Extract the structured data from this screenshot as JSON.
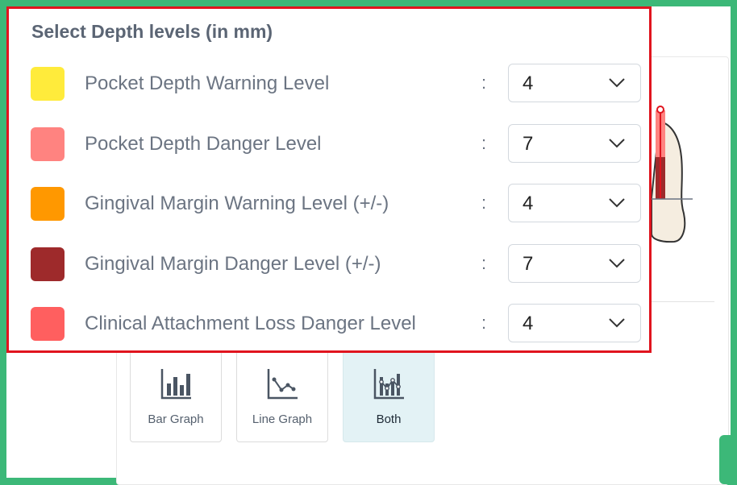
{
  "panel": {
    "title": "Select Depth levels (in mm)",
    "rows": [
      {
        "label": "Pocket Depth Warning Level",
        "color": "#ffeb3b",
        "value": "4"
      },
      {
        "label": "Pocket Depth Danger Level",
        "color": "#ff8380",
        "value": "7"
      },
      {
        "label": "Gingival Margin Warning Level (+/-)",
        "color": "#ff9800",
        "value": "4"
      },
      {
        "label": "Gingival Margin Danger Level (+/-)",
        "color": "#9e2a2b",
        "value": "7"
      },
      {
        "label": "Clinical Attachment Loss Danger Level",
        "color": "#ff5f5f",
        "value": "4"
      }
    ],
    "separator": ":"
  },
  "graph_types": {
    "buttons": [
      {
        "label": "Bar Graph",
        "icon": "bar-chart-icon"
      },
      {
        "label": "Line Graph",
        "icon": "line-chart-icon"
      },
      {
        "label": "Both",
        "icon": "combined-chart-icon",
        "selected": true
      }
    ]
  },
  "colors": {
    "frame": "#3cb878",
    "highlight_border": "#e0141e"
  }
}
